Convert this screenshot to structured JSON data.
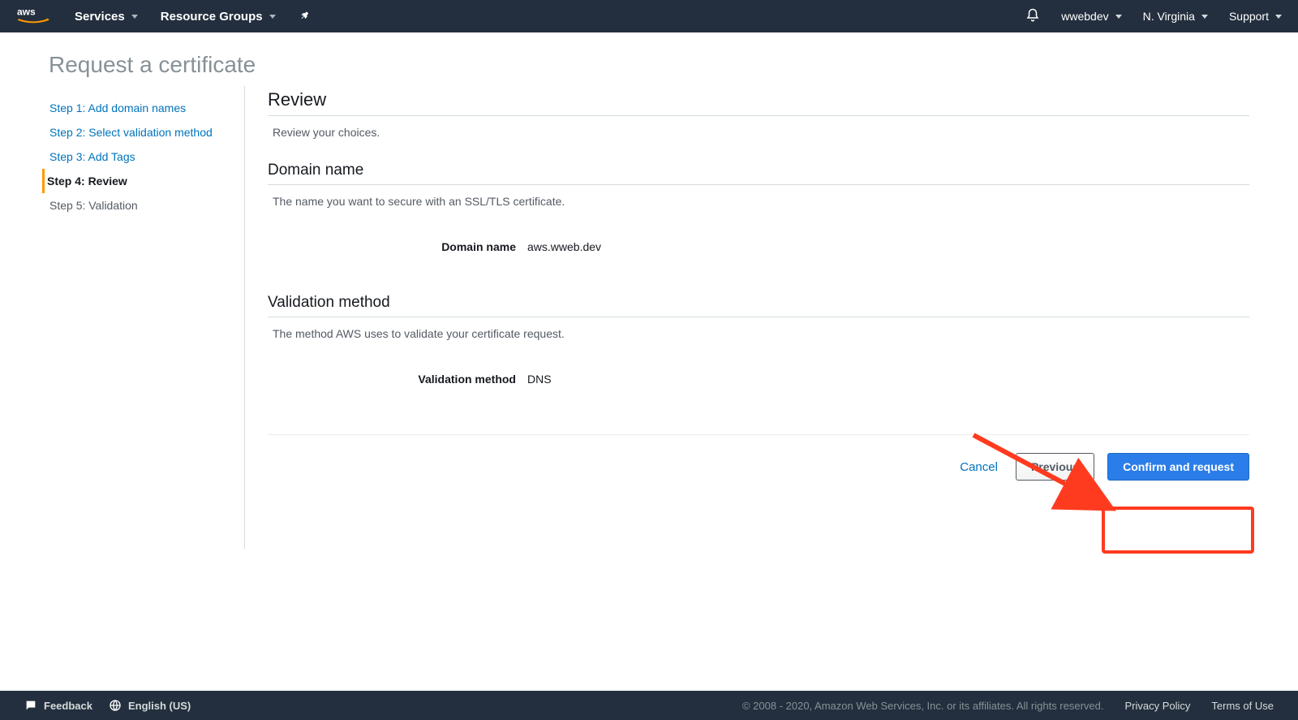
{
  "topnav": {
    "services": "Services",
    "resource_groups": "Resource Groups",
    "account": "wwebdev",
    "region": "N. Virginia",
    "support": "Support"
  },
  "page": {
    "title": "Request a certificate"
  },
  "steps": [
    {
      "label": "Step 1: Add domain names",
      "state": "link"
    },
    {
      "label": "Step 2: Select validation method",
      "state": "link"
    },
    {
      "label": "Step 3: Add Tags",
      "state": "link"
    },
    {
      "label": "Step 4: Review",
      "state": "current"
    },
    {
      "label": "Step 5: Validation",
      "state": "disabled"
    }
  ],
  "sections": {
    "review": {
      "title": "Review",
      "desc": "Review your choices."
    },
    "domain": {
      "title": "Domain name",
      "desc": "The name you want to secure with an SSL/TLS certificate.",
      "kv_label": "Domain name",
      "kv_value": "aws.wweb.dev"
    },
    "validation": {
      "title": "Validation method",
      "desc": "The method AWS uses to validate your certificate request.",
      "kv_label": "Validation method",
      "kv_value": "DNS"
    }
  },
  "actions": {
    "cancel": "Cancel",
    "previous": "Previous",
    "confirm": "Confirm and request"
  },
  "footer": {
    "feedback": "Feedback",
    "language": "English (US)",
    "copyright": "© 2008 - 2020, Amazon Web Services, Inc. or its affiliates. All rights reserved.",
    "privacy": "Privacy Policy",
    "terms": "Terms of Use"
  },
  "annotation": {
    "highlight_color": "#ff3b1f"
  }
}
